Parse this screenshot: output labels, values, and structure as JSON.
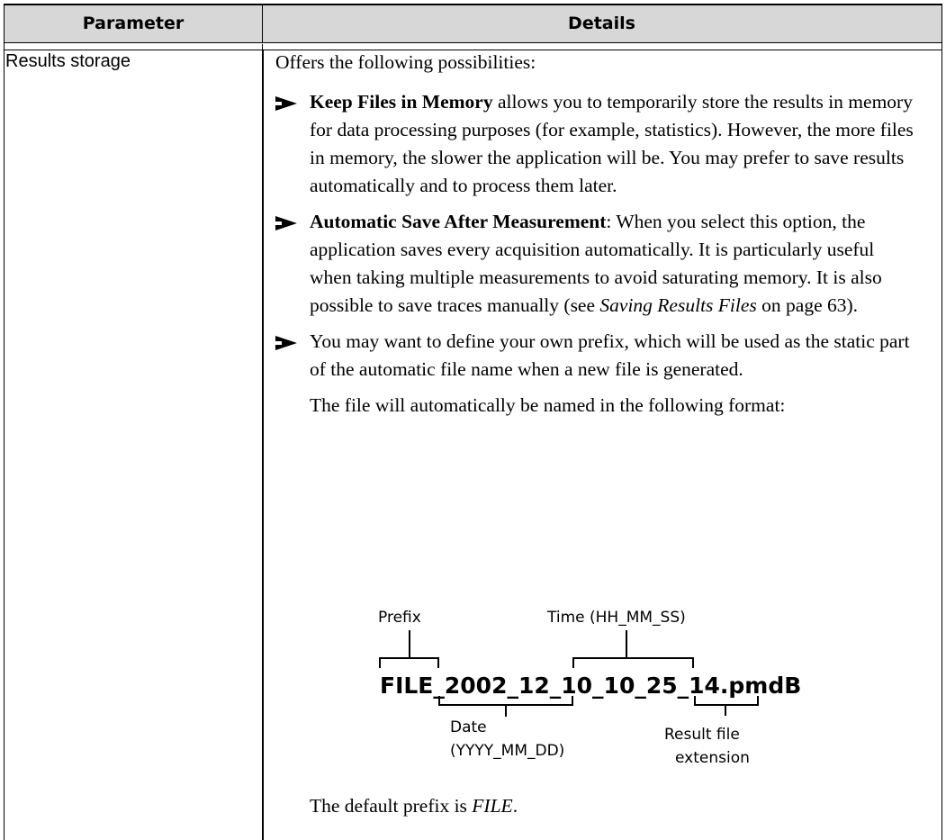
{
  "table": {
    "headers": [
      "Parameter",
      "Details"
    ],
    "parameter": "Results storage",
    "intro": "Offers the following possibilities:",
    "bullets": [
      {
        "bold": "Keep Files in Memory",
        "text": " allows you to temporarily store the results in memory for data processing purposes (for example, statistics). However, the more files in memory, the slower the application will be. You may prefer to save results automatically and to process them later."
      },
      {
        "bold": "Automatic Save After Measurement",
        "text_before_link": ": When you select this option, the application saves every acquisition automatically. It is particularly useful when taking multiple measurements to avoid saturating memory. It is also possible to save traces manually (see ",
        "link": "Saving Results Files",
        "text_after_link": " on page 63)."
      },
      {
        "text": "You may want to define your own prefix, which will be used as the static part of the automatic file name when a new file is generated."
      }
    ],
    "naming_note": "The file will automatically be named in the following format:",
    "diagram": {
      "filename": "FILE_2002_12_10_10_25_14.pmdB",
      "label_prefix": "Prefix",
      "label_time": "Time (HH_MM_SS)",
      "label_date_line1": "Date",
      "label_date_line2": "(YYYY_MM_DD)",
      "label_ext_line1": "Result file",
      "label_ext_line2": "extension"
    },
    "default_prefix_text": "The default prefix is ",
    "default_prefix_value": "FILE",
    "default_prefix_end": "."
  }
}
